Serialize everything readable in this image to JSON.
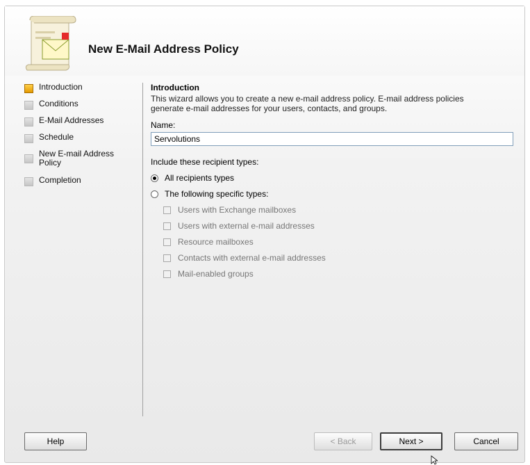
{
  "window": {
    "title": "New E-Mail Address Policy"
  },
  "steps": [
    {
      "label": "Introduction",
      "active": true
    },
    {
      "label": "Conditions"
    },
    {
      "label": "E-Mail Addresses"
    },
    {
      "label": "Schedule"
    },
    {
      "label": "New E-mail Address Policy"
    },
    {
      "label": "Completion"
    }
  ],
  "intro": {
    "heading": "Introduction",
    "description_line1": "This wizard allows you to create a new e-mail address policy. E-mail address policies",
    "description_line2": "generate e-mail addresses for your users, contacts, and groups."
  },
  "name_field": {
    "label": "Name:",
    "value": "Servolutions"
  },
  "recipient_types": {
    "label": "Include these recipient types:",
    "all_option": "All recipients types",
    "specific_option": "The following specific types:",
    "selected": "all",
    "checkboxes": [
      "Users with Exchange mailboxes",
      "Users with external e-mail addresses",
      "Resource mailboxes",
      "Contacts with external e-mail addresses",
      "Mail-enabled groups"
    ]
  },
  "buttons": {
    "help": "Help",
    "back": "< Back",
    "next": "Next >",
    "cancel": "Cancel"
  }
}
